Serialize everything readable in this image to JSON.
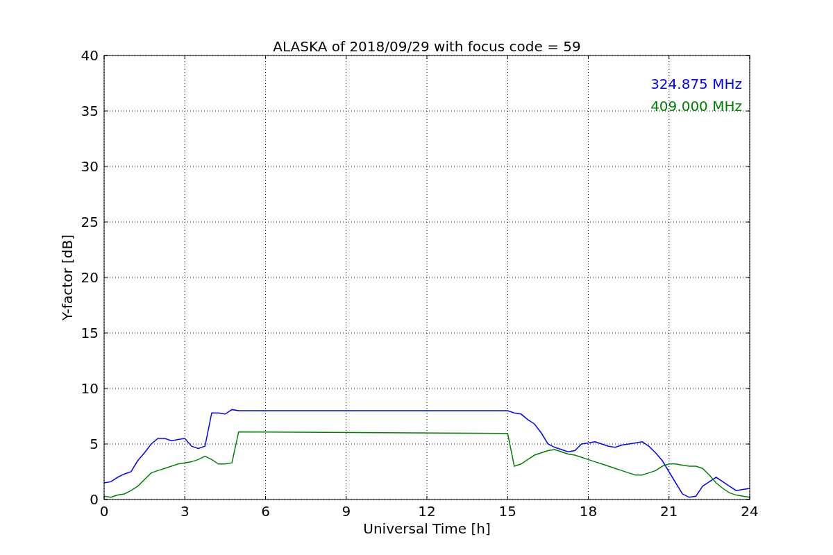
{
  "chart_data": {
    "type": "line",
    "title": "ALASKA of 2018/09/29 with focus code = 59",
    "xlabel": "Universal Time [h]",
    "ylabel": "Y-factor [dB]",
    "x": [
      0,
      0.25,
      0.5,
      0.75,
      1,
      1.25,
      1.5,
      1.75,
      2,
      2.25,
      2.5,
      2.75,
      3,
      3.25,
      3.5,
      3.75,
      4,
      4.25,
      4.5,
      4.75,
      5,
      15,
      15.25,
      15.5,
      15.75,
      16,
      16.25,
      16.5,
      16.75,
      17,
      17.25,
      17.5,
      17.75,
      18,
      18.25,
      18.5,
      18.75,
      19,
      19.25,
      19.5,
      19.75,
      20,
      20.25,
      20.5,
      20.75,
      21,
      21.25,
      21.5,
      21.75,
      22,
      22.25,
      22.5,
      22.75,
      23,
      23.25,
      23.5,
      23.75,
      24
    ],
    "series": [
      {
        "name": "324.875 MHz",
        "color": "#0000ff",
        "values": [
          1.5,
          1.6,
          2.0,
          2.3,
          2.5,
          3.5,
          4.2,
          5.0,
          5.5,
          5.5,
          5.3,
          5.4,
          5.5,
          4.8,
          4.6,
          4.8,
          7.8,
          7.8,
          7.7,
          8.1,
          8.0,
          8.0,
          7.8,
          7.7,
          7.2,
          6.8,
          6.0,
          5.0,
          4.7,
          4.5,
          4.3,
          4.4,
          5.0,
          5.1,
          5.2,
          5.0,
          4.8,
          4.7,
          4.9,
          5.0,
          5.1,
          5.2,
          4.8,
          4.2,
          3.5,
          2.5,
          1.5,
          0.5,
          0.2,
          0.3,
          1.2,
          1.6,
          2.0,
          1.6,
          1.2,
          0.8,
          0.9,
          1.0
        ]
      },
      {
        "name": "409.000 MHz",
        "color": "#008000",
        "values": [
          0.3,
          0.2,
          0.4,
          0.5,
          0.8,
          1.2,
          1.8,
          2.4,
          2.6,
          2.8,
          3.0,
          3.2,
          3.3,
          3.4,
          3.6,
          3.9,
          3.6,
          3.2,
          3.2,
          3.3,
          6.1,
          5.95,
          3.0,
          3.2,
          3.6,
          4.0,
          4.2,
          4.4,
          4.5,
          4.3,
          4.1,
          4.0,
          3.8,
          3.6,
          3.4,
          3.2,
          3.0,
          2.8,
          2.6,
          2.4,
          2.2,
          2.2,
          2.4,
          2.6,
          3.0,
          3.2,
          3.2,
          3.1,
          3.0,
          3.0,
          2.8,
          2.2,
          1.5,
          1.0,
          0.6,
          0.4,
          0.3,
          0.2
        ]
      }
    ],
    "xlim": [
      0,
      24
    ],
    "ylim": [
      0,
      40
    ],
    "xticks": [
      0,
      3,
      6,
      9,
      12,
      15,
      18,
      21,
      24
    ],
    "yticks": [
      0,
      5,
      10,
      15,
      20,
      25,
      30,
      35,
      40
    ],
    "grid": true
  }
}
